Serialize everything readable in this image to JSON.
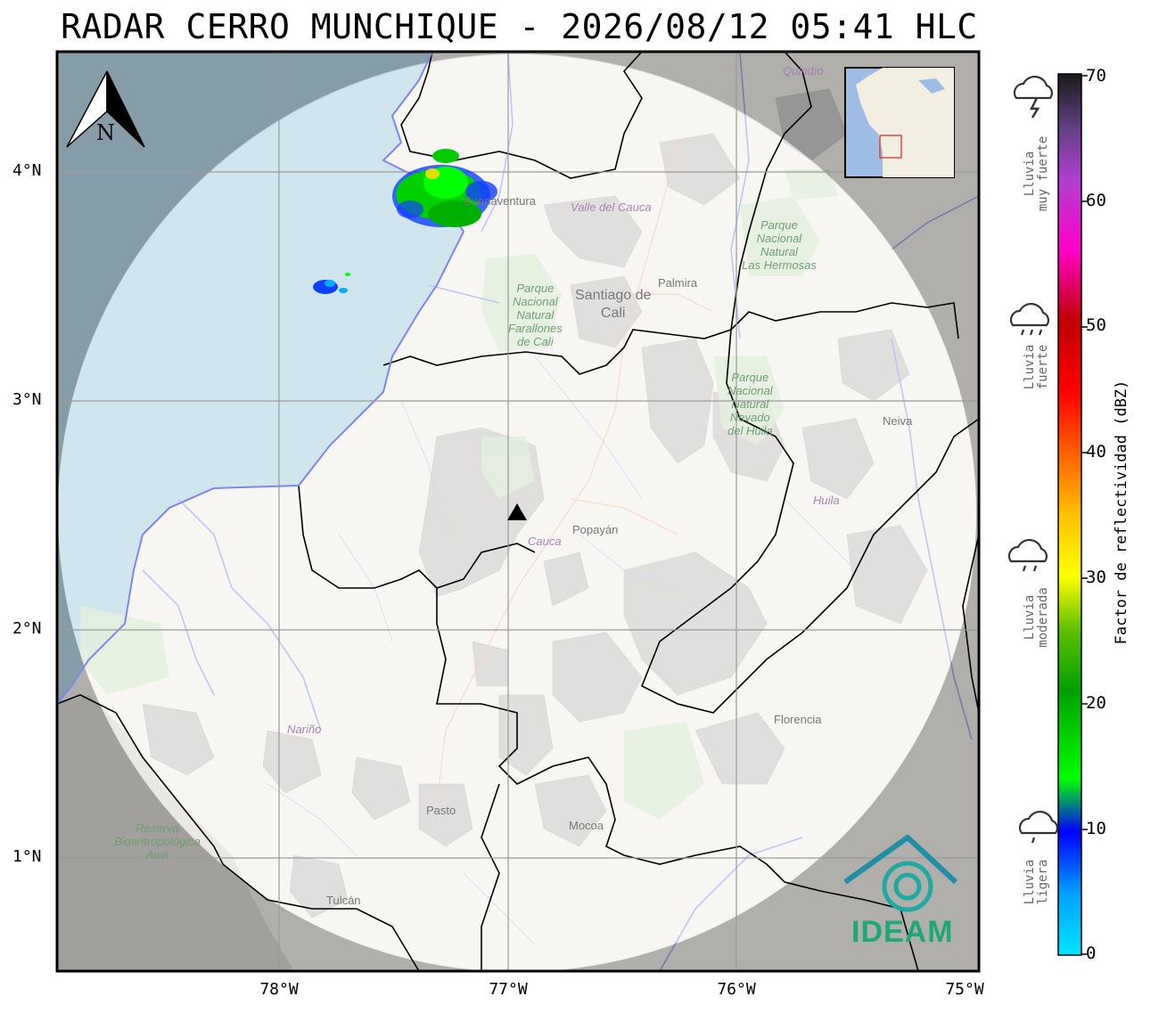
{
  "title": "RADAR CERRO MUNCHIQUE - 2026/08/12 05:41 HLC",
  "north_arrow_label": "N",
  "lat_labels": [
    "4°N",
    "3°N",
    "2°N",
    "1°N"
  ],
  "lon_labels": [
    "78°W",
    "77°W",
    "76°W",
    "75°W"
  ],
  "colorbar": {
    "title": "Factor de reflectividad (dBZ)",
    "ticks": [
      "70",
      "60",
      "50",
      "40",
      "30",
      "20",
      "10",
      "0"
    ],
    "colors": [
      "#00e5ff",
      "#0066ff",
      "#0000ff",
      "#00ff00",
      "#00c800",
      "#008c00",
      "#ffff00",
      "#ffd000",
      "#ff9000",
      "#ff0000",
      "#d40000",
      "#c00000",
      "#ff00ff",
      "#9955cc",
      "#6040a0",
      "#202020"
    ]
  },
  "rain_categories": [
    {
      "line1": "Lluvia",
      "line2": "muy fuerte",
      "icon": "storm-cloud-icon"
    },
    {
      "line1": "Lluvia",
      "line2": "fuerte",
      "icon": "heavy-rain-cloud-icon"
    },
    {
      "line1": "Lluvia",
      "line2": "moderada",
      "icon": "rain-cloud-icon"
    },
    {
      "line1": "Lluvia",
      "line2": "ligera",
      "icon": "light-rain-cloud-icon"
    }
  ],
  "map_labels": {
    "quindio": "Quindío",
    "valle": "Valle del Cauca",
    "buenaventura": "Buenaventura",
    "parque_hermosas": [
      "Parque",
      "Nacional",
      "Natural",
      "Las Hermosas"
    ],
    "palmira": "Palmira",
    "cali": [
      "Santiago de",
      "Cali"
    ],
    "farallones": [
      "Parque",
      "Nacional",
      "Natural",
      "Farallones",
      "de Cali"
    ],
    "neiva": "Neiva",
    "parque_nevado": [
      "Parque",
      "Nacional",
      "Natural",
      "Nevado",
      "del Huila"
    ],
    "huila": "Huila",
    "cauca": "Cauca",
    "popayan": "Popayán",
    "narino": "Nariño",
    "florencia": "Florencia",
    "pasto": "Pasto",
    "mocoa": "Mocoa",
    "reserva": [
      "Reserva",
      "Bioantropológica",
      "Awá"
    ],
    "tulcan": "Tulcán"
  },
  "logo_text": "IDEAM"
}
